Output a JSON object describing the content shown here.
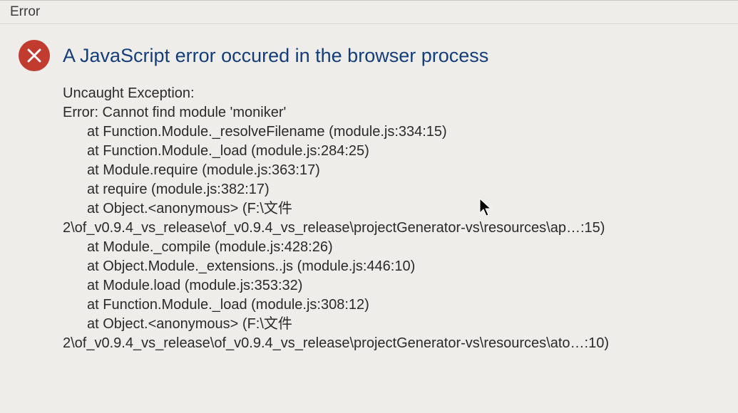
{
  "window": {
    "title": "Error"
  },
  "dialog": {
    "heading": "A JavaScript error occured in the browser process",
    "lines": [
      {
        "t": "Uncaught Exception:",
        "i": 0
      },
      {
        "t": "Error: Cannot find module 'moniker'",
        "i": 0
      },
      {
        "t": "at Function.Module._resolveFilename (module.js:334:15)",
        "i": 1
      },
      {
        "t": "at Function.Module._load (module.js:284:25)",
        "i": 1
      },
      {
        "t": "at Module.require (module.js:363:17)",
        "i": 1
      },
      {
        "t": "at require (module.js:382:17)",
        "i": 1
      },
      {
        "t": "at Object.<anonymous> (F:\\文件",
        "i": 1
      },
      {
        "t": "2\\of_v0.9.4_vs_release\\of_v0.9.4_vs_release\\projectGenerator-vs\\resources\\ap…:15)",
        "i": 0
      },
      {
        "t": "at Module._compile (module.js:428:26)",
        "i": 1
      },
      {
        "t": "at Object.Module._extensions..js (module.js:446:10)",
        "i": 1
      },
      {
        "t": "at Module.load (module.js:353:32)",
        "i": 1
      },
      {
        "t": "at Function.Module._load (module.js:308:12)",
        "i": 1
      },
      {
        "t": "at Object.<anonymous> (F:\\文件",
        "i": 1
      },
      {
        "t": "2\\of_v0.9.4_vs_release\\of_v0.9.4_vs_release\\projectGenerator-vs\\resources\\ato…:10)",
        "i": 0
      }
    ]
  }
}
